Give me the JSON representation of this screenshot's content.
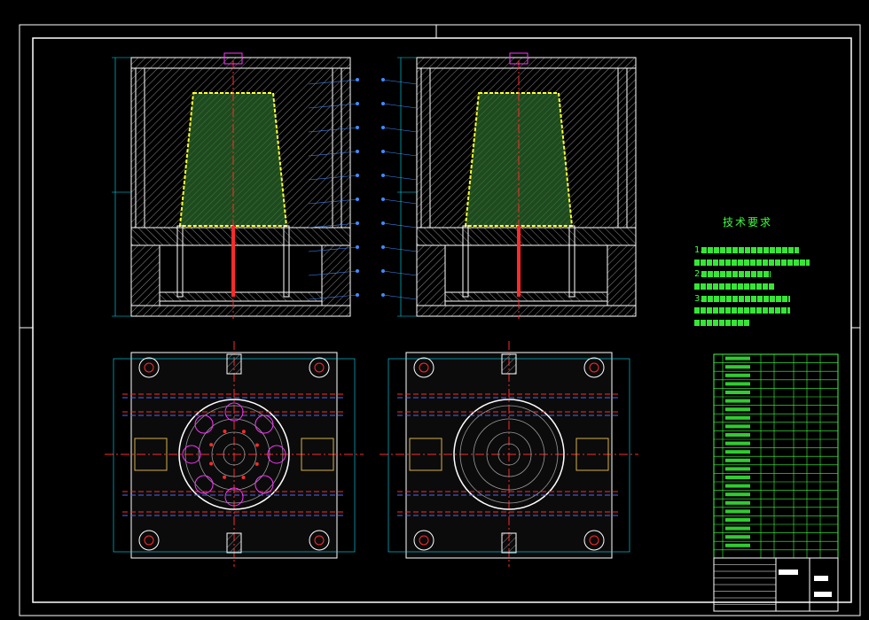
{
  "drawing": {
    "background": "#000000",
    "colors": {
      "frame": "#ffffff",
      "outline": "#ffffff",
      "hatch": "#8a8a8a",
      "part_fill": "#1f5a1f",
      "part_outline": "#ffff33",
      "centerline": "#ff2a2a",
      "dimension": "#00e5ff",
      "leader": "#3f8cff",
      "text": "#3cff3c",
      "feature": "#ff33ff"
    },
    "views": [
      "front-section-left",
      "front-section-right",
      "plan-fixed-half",
      "plan-moving-half"
    ],
    "technical_requirements": {
      "title": "技术要求",
      "items": [
        {
          "number": "1."
        },
        {
          "number": "2."
        },
        {
          "number": "3."
        }
      ]
    },
    "bom_rows": 24,
    "title_block": {
      "present": true
    }
  }
}
